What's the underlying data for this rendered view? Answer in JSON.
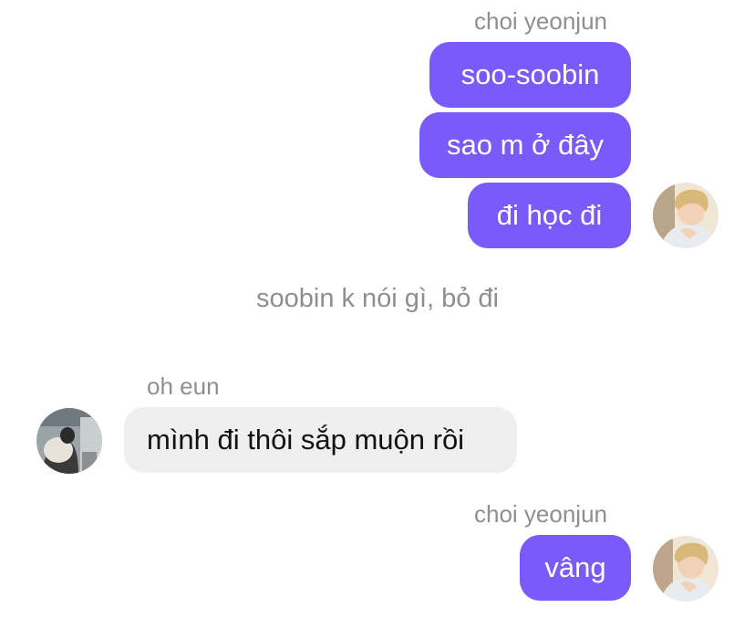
{
  "chat": {
    "group1": {
      "sender": "choi yeonjun",
      "messages": [
        "soo-soobin",
        "sao m ở đây",
        "đi học đi"
      ],
      "avatar_icon": "user-avatar-photo-icon"
    },
    "system_message": "soobin k nói gì, bỏ đi",
    "group2": {
      "sender": "oh eun",
      "messages": [
        "mình đi thôi sắp muộn rồi"
      ],
      "avatar_icon": "user-avatar-photo-icon"
    },
    "group3": {
      "sender": "choi yeonjun",
      "messages": [
        "vâng"
      ],
      "avatar_icon": "user-avatar-photo-icon"
    }
  },
  "colors": {
    "outgoing_bubble": "#7a5af8",
    "incoming_bubble": "#efefef",
    "meta_text": "#8e8e93"
  }
}
